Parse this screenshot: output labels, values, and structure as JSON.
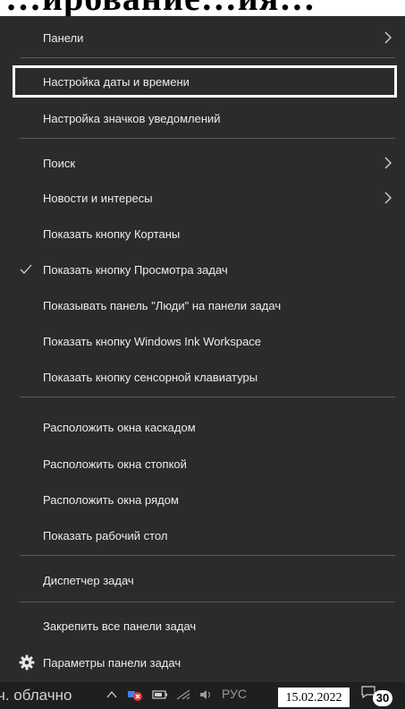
{
  "page_heading": "…ирование…ия…",
  "menu": {
    "items": [
      {
        "label": "Панели",
        "has_submenu": true
      },
      {
        "label": "Настройка даты и времени",
        "selected": true
      },
      {
        "label": "Настройка значков уведомлений"
      },
      {
        "label": "Поиск",
        "has_submenu": true
      },
      {
        "label": "Новости и интересы",
        "has_submenu": true
      },
      {
        "label": "Показать кнопку Кортаны"
      },
      {
        "label": "Показать кнопку Просмотра задач",
        "checked": true
      },
      {
        "label": "Показывать панель \"Люди\" на панели задач"
      },
      {
        "label": "Показать кнопку Windows Ink Workspace"
      },
      {
        "label": "Показать кнопку сенсорной клавиатуры"
      },
      {
        "label": "Расположить окна каскадом"
      },
      {
        "label": "Расположить окна стопкой"
      },
      {
        "label": "Расположить окна рядом"
      },
      {
        "label": "Показать рабочий стол"
      },
      {
        "label": "Диспетчер задач"
      },
      {
        "label": "Закрепить все панели задач"
      },
      {
        "label": "Параметры панели задач",
        "icon": "gear-icon"
      }
    ]
  },
  "taskbar": {
    "weather_text": "ч. облачно",
    "tray_icons": [
      "chevron-up-icon",
      "security-icon",
      "battery-icon",
      "network-icon",
      "volume-icon",
      "language-indicator"
    ],
    "language": "РУС",
    "date": "15.02.2022",
    "notification_count": "30"
  },
  "colors": {
    "menu_bg": "#2b2b2b",
    "menu_text": "#ececec",
    "separator": "#5a5a5a",
    "taskbar_bg": "#1f1f1f"
  }
}
